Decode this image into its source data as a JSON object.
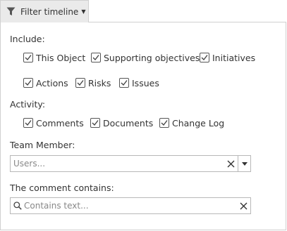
{
  "toolbar": {
    "filter_label": "Filter timeline",
    "filter_icon": "funnel-icon",
    "caret_icon": "chevron-down-icon"
  },
  "include": {
    "label": "Include:",
    "options": [
      {
        "label": "This Object",
        "checked": true
      },
      {
        "label": "Supporting objectives",
        "checked": true
      },
      {
        "label": "Initiatives",
        "checked": true
      },
      {
        "label": "Actions",
        "checked": true
      },
      {
        "label": "Risks",
        "checked": true
      },
      {
        "label": "Issues",
        "checked": true
      }
    ]
  },
  "activity": {
    "label": "Activity:",
    "options": [
      {
        "label": "Comments",
        "checked": true
      },
      {
        "label": "Documents",
        "checked": true
      },
      {
        "label": "Change Log",
        "checked": true
      }
    ]
  },
  "team_member": {
    "label": "Team Member:",
    "placeholder": "Users...",
    "value": ""
  },
  "comment": {
    "label": "The comment contains:",
    "placeholder": "Contains text...",
    "value": ""
  }
}
